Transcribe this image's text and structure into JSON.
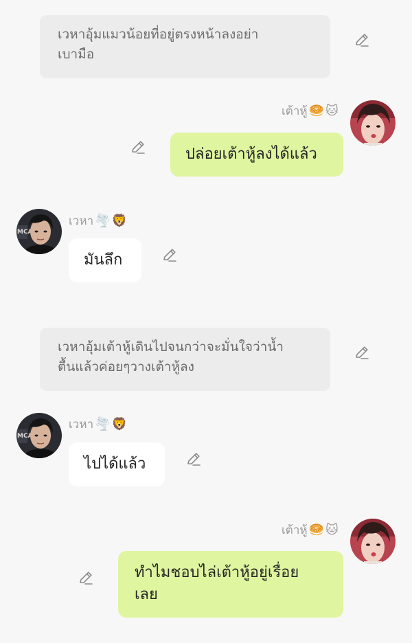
{
  "characters": {
    "right": {
      "name": "เต้าหู้",
      "emojis": [
        "🥯",
        "🐱"
      ]
    },
    "left": {
      "name": "เวหา",
      "emojis": [
        "🌪️",
        "🦁"
      ]
    }
  },
  "messages": [
    {
      "type": "narration",
      "text": "เวหาอุ้มแมวน้อยที่อยู่ตรงหน้าลงอย่าเบามือ",
      "line1": "เวหาอุ้มแมวน้อยที่อยู่ตรงหน้าลงอย่า",
      "line2": "เบามือ"
    },
    {
      "type": "outgoing",
      "text": "ปล่อยเต้าหู้ลงได้แล้ว"
    },
    {
      "type": "incoming",
      "text": "มันลึก"
    },
    {
      "type": "narration",
      "text": "เวหาอุ้มเต้าหู้เดินไปจนกว่าจะมั่นใจว่าน้ำตื้นแล้วค่อยๆวางเต้าหู้ลง",
      "line1": "เวหาอุ้มเต้าหู้เดินไปจนกว่าจะมั่นใจว่าน้ำ",
      "line2": "ตื้นแล้วค่อยๆวางเต้าหู้ลง"
    },
    {
      "type": "incoming",
      "text": "ไปได้แล้ว"
    },
    {
      "type": "outgoing",
      "text": "ทำไมชอบไล่เต้าหู้อยู่เรื่อยเลย",
      "line1": "ทำไมชอบไล่เต้าหู้อยู่เรื่อย",
      "line2": "เลย"
    }
  ],
  "colors": {
    "background": "#f7f7f7",
    "narration_bg": "#ececec",
    "outgoing_bg": "#dff59f",
    "incoming_bg": "#ffffff"
  },
  "icons": [
    "pencil-edit-icon",
    "avatar-right",
    "avatar-left"
  ]
}
